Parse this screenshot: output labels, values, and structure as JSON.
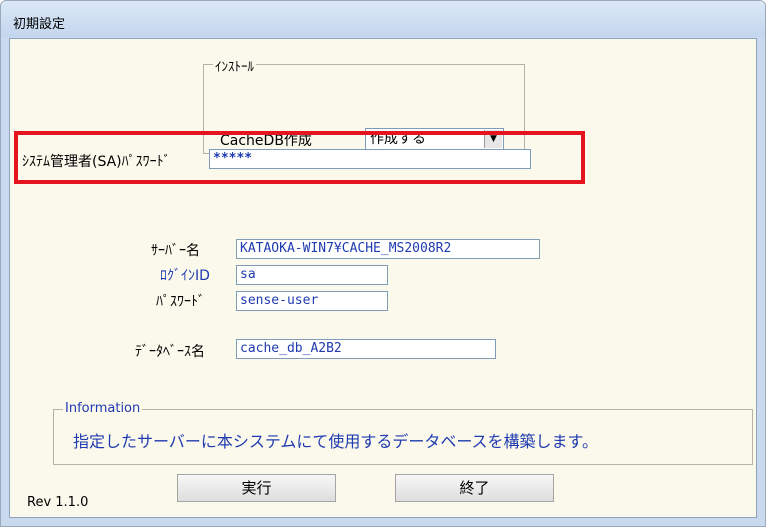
{
  "window": {
    "title": "初期設定"
  },
  "install_group": {
    "legend": "ｲﾝｽﾄｰﾙ",
    "cachedb_label": "CacheDB作成",
    "cachedb_value": "作成する"
  },
  "sa_password": {
    "label": "ｼｽﾃﾑ管理者(SA)ﾊﾟｽﾜｰﾄﾞ",
    "value": "*****"
  },
  "server": {
    "label": "ｻｰﾊﾞｰ名",
    "value": "KATAOKA-WIN7¥CACHE_MS2008R2"
  },
  "login_id": {
    "label": "ﾛｸﾞｲﾝID",
    "value": "sa"
  },
  "password": {
    "label": "ﾊﾟｽﾜｰﾄﾞ",
    "value": "sense-user"
  },
  "database": {
    "label": "ﾃﾞｰﾀﾍﾞｰｽ名",
    "value": "cache_db_A2B2"
  },
  "information": {
    "legend": "Information",
    "text": "指定したサーバーに本システムにて使用するデータベースを構築します。"
  },
  "buttons": {
    "run": "実行",
    "exit": "終了"
  },
  "version": "Rev 1.1.0",
  "colors": {
    "highlight": "#e6141e",
    "label_blue": "#1f3bb0",
    "background": "#fbf8ec"
  }
}
